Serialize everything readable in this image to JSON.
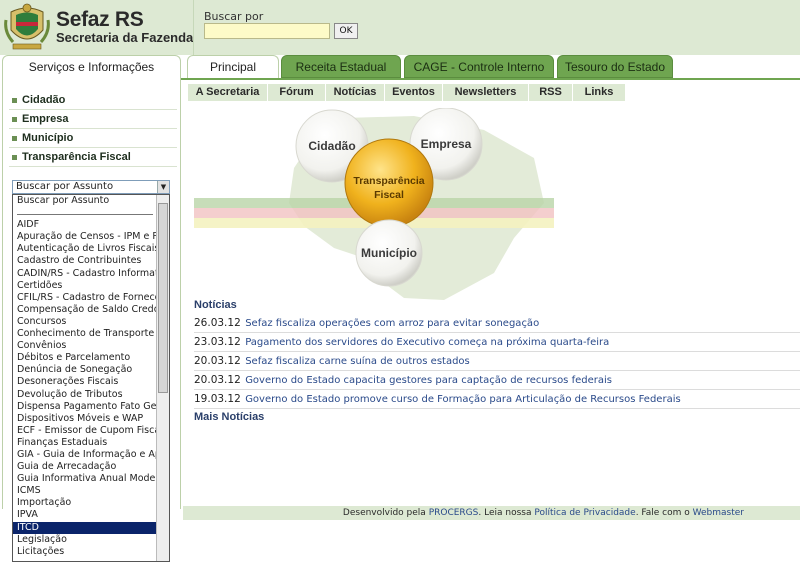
{
  "brand": {
    "title": "Sefaz RS",
    "subtitle": "Secretaria da Fazenda",
    "logo_icon": "coat-of-arms-icon"
  },
  "search": {
    "label": "Buscar por",
    "value": "",
    "button_label": "OK"
  },
  "sidebar": {
    "tab_label": "Serviços e Informações",
    "items": [
      {
        "label": "Cidadão"
      },
      {
        "label": "Empresa"
      },
      {
        "label": "Município"
      },
      {
        "label": "Transparência Fiscal"
      }
    ],
    "select_value": "Buscar por Assunto",
    "dropdown_options": [
      "Buscar por Assunto",
      "----------",
      "AIDF",
      "Apuração de Censos - IPM e PIT",
      "Autenticação de Livros Fiscais",
      "Cadastro de Contribuintes",
      "CADIN/RS - Cadastro Informativo",
      "Certidões",
      "CFIL/RS - Cadastro de Fornecedo",
      "Compensação de Saldo Credor",
      "Concursos",
      "Conhecimento de Transporte Elet",
      "Convênios",
      "Débitos e Parcelamento",
      "Denúncia de Sonegação",
      "Desonerações Fiscais",
      "Devolução de Tributos",
      "Dispensa Pagamento Fato Gerad",
      "Dispositivos Móveis e WAP",
      "ECF - Emissor de Cupom Fiscal",
      "Finanças Estaduais",
      "GIA - Guia de Informação e Apura",
      "Guia de Arrecadação",
      "Guia Informativa Anual Modelos A",
      "ICMS",
      "Importação",
      "IPVA",
      "ITCD",
      "Legislação",
      "Licitações"
    ],
    "selected_option": "ITCD"
  },
  "tabs": [
    {
      "label": "Principal",
      "active": true
    },
    {
      "label": "Receita Estadual",
      "active": false
    },
    {
      "label": "CAGE - Controle Interno",
      "active": false
    },
    {
      "label": "Tesouro do Estado",
      "active": false
    }
  ],
  "subnav": [
    "A Secretaria",
    "Fórum",
    "Notícias",
    "Eventos",
    "Newsletters",
    "RSS",
    "Links"
  ],
  "hero": {
    "cidadao": "Cidadão",
    "empresa": "Empresa",
    "transparencia_line1": "Transparência",
    "transparencia_line2": "Fiscal",
    "municipio": "Município"
  },
  "news": {
    "title": "Notícias",
    "items": [
      {
        "date": "26.03.12",
        "text": "Sefaz fiscaliza operações com arroz para evitar sonegação"
      },
      {
        "date": "23.03.12",
        "text": "Pagamento dos servidores do Executivo começa na próxima quarta-feira"
      },
      {
        "date": "20.03.12",
        "text": "Sefaz fiscaliza carne suína de outros estados"
      },
      {
        "date": "20.03.12",
        "text": "Governo do Estado capacita gestores para captação de recursos federais"
      },
      {
        "date": "19.03.12",
        "text": "Governo do Estado promove curso de Formação para Articulação de Recursos Federais"
      }
    ],
    "more": "Mais Notícias"
  },
  "footer": {
    "prefix": "Desenvolvido pela",
    "procergs": "PROCERGS",
    "sep1": ". Leia nossa",
    "privacy": "Política de Privacidade",
    "sep2": ". Fale com o",
    "webmaster": "Webmaster"
  },
  "colors": {
    "header_bg": "#dde9d3",
    "tab_green": "#6fa550",
    "link_blue": "#2a4a8a",
    "select_highlight": "#0a246a",
    "hero_gold": "#e8a81a"
  }
}
